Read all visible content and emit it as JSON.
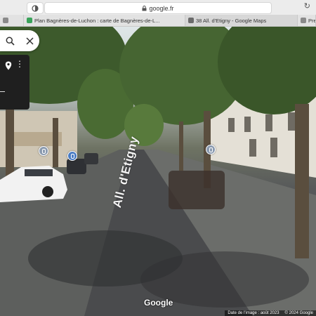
{
  "browser": {
    "url": "google.fr",
    "tabs": [
      {
        "label": "",
        "favicon_color": "#8a8a8a"
      },
      {
        "label": "Plan Bagnères-de-Luchon : carte de Bagnères-de-L...",
        "favicon_color": "#3aa35a"
      },
      {
        "label": "38 All. d'Etigny - Google Maps",
        "favicon_color": "#6b6b6b"
      },
      {
        "label": "Pre",
        "favicon_color": "#8a8a8a"
      }
    ]
  },
  "street_view": {
    "street_name": "All. d'Etigny",
    "google_logo": "Google",
    "image_date": "Date de l'image : août 2023",
    "copyright": "© 2024 Google"
  },
  "colors": {
    "accent": "#4a7cc4",
    "panel_dark": "#1f1f1f"
  },
  "icons": {
    "search": "search-icon",
    "close": "close-icon",
    "pin": "location-pin-icon",
    "more": "more-vertical-icon",
    "shield": "shield-icon",
    "lock": "lock-icon",
    "reload": "reload-icon"
  }
}
